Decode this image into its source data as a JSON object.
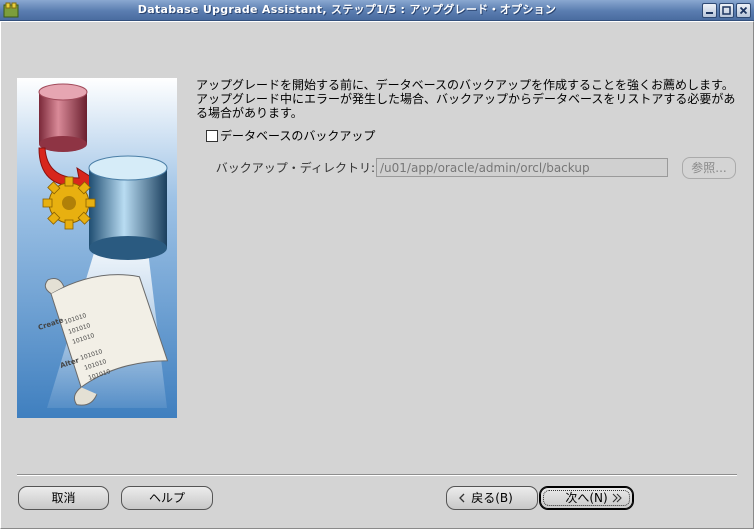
{
  "window": {
    "title": "Database Upgrade Assistant, ステップ1/5 : アップグレード・オプション"
  },
  "description": {
    "line1": "アップグレードを開始する前に、データベースのバックアップを作成することを強くお薦めします。",
    "line2": "アップグレード中にエラーが発生した場合、バックアップからデータベースをリストアする必要があ",
    "line3": "る場合があります。"
  },
  "backup": {
    "checkbox_label": "データベースのバックアップ",
    "checked": false,
    "directory_label": "バックアップ・ディレクトリ:",
    "directory_value": "/u01/app/oracle/admin/orcl/backup",
    "browse_label": "参照..."
  },
  "illustration": {
    "scroll_words": [
      "Create",
      "Alter"
    ],
    "scroll_digits": "101010"
  },
  "buttons": {
    "cancel": "取消",
    "help": "ヘルプ",
    "back": "戻る(B)",
    "next": "次へ(N)"
  },
  "colors": {
    "titlebar": "#5a7db0",
    "background": "#d4d4d4"
  }
}
